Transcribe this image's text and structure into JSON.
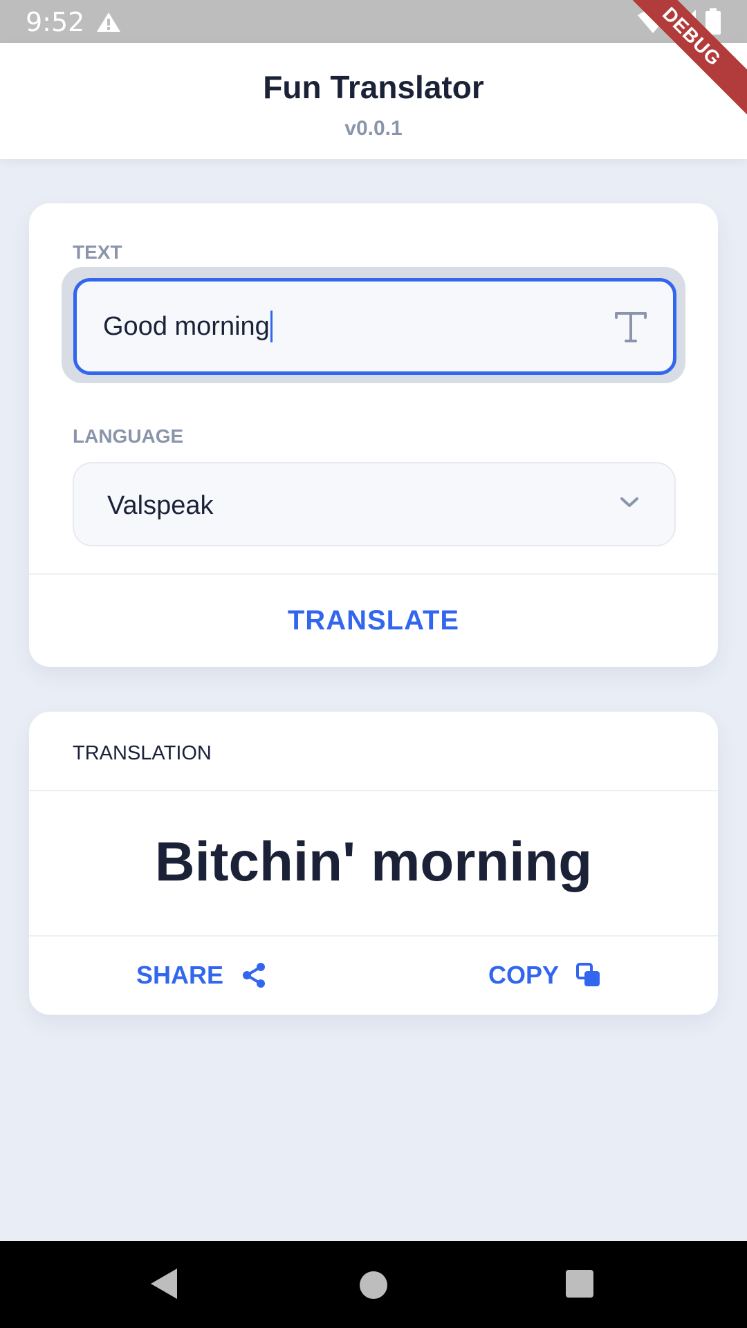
{
  "status_bar": {
    "time": "9:52",
    "icons": [
      "warning-icon",
      "wifi-icon",
      "signal-icon",
      "battery-icon"
    ]
  },
  "debug_banner": "DEBUG",
  "app_bar": {
    "title": "Fun Translator",
    "version": "v0.0.1"
  },
  "input_card": {
    "text_label": "TEXT",
    "text_value": "Good morning",
    "text_icon": "text-format-icon",
    "language_label": "LANGUAGE",
    "language_value": "Valspeak",
    "translate_label": "TRANSLATE"
  },
  "result_card": {
    "header": "TRANSLATION",
    "translation": "Bitchin' morning",
    "share_label": "SHARE",
    "copy_label": "COPY"
  },
  "nav_bar": {
    "buttons": [
      "back-icon",
      "home-icon",
      "recents-icon"
    ]
  },
  "colors": {
    "accent": "#3366ee",
    "text_primary": "#1b2238",
    "text_muted": "#8a94aa",
    "background": "#e9edf5",
    "debug_banner": "#b23b3b"
  }
}
